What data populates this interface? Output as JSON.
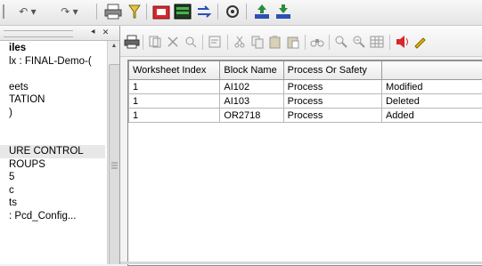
{
  "toolbar_top": {
    "undo_label": "↶ ▾",
    "redo_label": "↷ ▾"
  },
  "left_pane": {
    "dock_button": "⯇",
    "close_button": "✕",
    "scroll_up": "▲",
    "tree_items": [
      {
        "label": "iles"
      },
      {
        "label": "lx : FINAL-Demo-("
      },
      {
        "label": ""
      },
      {
        "label": "eets"
      },
      {
        "label": "TATION"
      },
      {
        "label": ")"
      },
      {
        "label": ""
      },
      {
        "label": ""
      },
      {
        "label": "URE CONTROL"
      },
      {
        "label": "ROUPS"
      },
      {
        "label": "5"
      },
      {
        "label": "c"
      },
      {
        "label": "ts"
      },
      {
        "label": " : Pcd_Config..."
      }
    ]
  },
  "grid": {
    "columns": [
      "Worksheet Index",
      "Block Name",
      "Process Or Safety",
      ""
    ],
    "rows": [
      [
        "1",
        "AI102",
        "Process",
        "Modified"
      ],
      [
        "1",
        "AI103",
        "Process",
        "Deleted"
      ],
      [
        "1",
        "OR2718",
        "Process",
        "Added"
      ]
    ]
  },
  "colors": {
    "accent_red": "#d8262b",
    "accent_green": "#2a8c3a",
    "accent_blue": "#2c4fb5"
  }
}
